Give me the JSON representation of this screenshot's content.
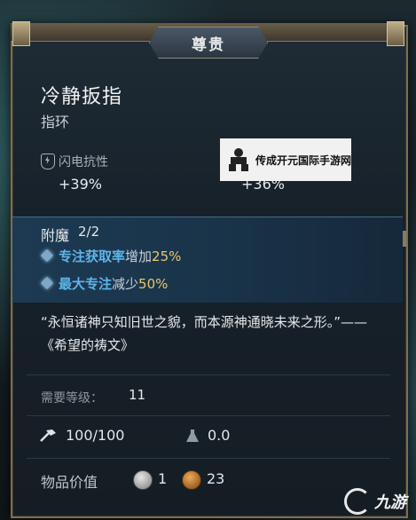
{
  "tooltip": {
    "rarity": "尊贵",
    "name": "冷静扳指",
    "type": "指环",
    "resistances": [
      {
        "label": "闪电抗性",
        "value": "+39%",
        "icon": "lightning-shield-icon"
      },
      {
        "label": "",
        "value": "+36%",
        "icon": "shield-icon"
      }
    ],
    "enchant": {
      "title": "附魔",
      "count": "2/2",
      "mods": [
        {
          "name": "专注获取率",
          "verb": "增加",
          "amount": "25%"
        },
        {
          "name": "最大专注",
          "verb": "减少",
          "amount": "50%"
        }
      ]
    },
    "lore": "“永恒诸神只知旧世之貌，而本源神通晓未来之形。”——《希望的祷文》",
    "requirement": {
      "label": "需要等级：",
      "value": "11"
    },
    "durability": "100/100",
    "weight": "0.0",
    "item_value": {
      "label": "物品价值",
      "silver": "1",
      "gold": "23"
    }
  },
  "watermarks": {
    "top_text": "传成开元国际手游网",
    "bottom_text": "九游"
  },
  "colors": {
    "modifier": "#5eb4e8",
    "amount": "#e9c76d",
    "frame": "#7d6d52"
  }
}
